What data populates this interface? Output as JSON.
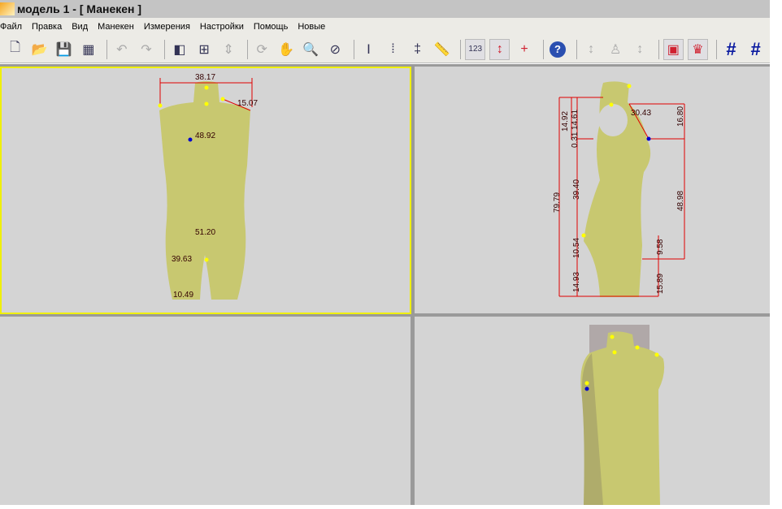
{
  "title": "модель 1 - [ Манекен     ]",
  "menu": [
    "Файл",
    "Правка",
    "Вид",
    "Манекен",
    "Измерения",
    "Настройки",
    "Помощь",
    "Новые"
  ],
  "toolbar": [
    {
      "icon": "new-document-icon"
    },
    {
      "icon": "open-folder-icon"
    },
    {
      "icon": "save-icon"
    },
    {
      "icon": "save-all-icon"
    },
    {
      "icon": "undo-icon"
    },
    {
      "icon": "redo-icon"
    },
    {
      "icon": "view-cube-icon"
    },
    {
      "icon": "layout-icon"
    },
    {
      "icon": "fit-icon"
    },
    {
      "icon": "rotate-icon"
    },
    {
      "icon": "pan-hand-icon"
    },
    {
      "icon": "zoom-icon"
    },
    {
      "icon": "zoom-window-icon"
    },
    {
      "icon": "vertical-measure-icon"
    },
    {
      "icon": "vertical-measure-2-icon"
    },
    {
      "icon": "vertical-measure-3-icon"
    },
    {
      "icon": "ruler-icon"
    },
    {
      "icon": "show-values-icon",
      "active": true
    },
    {
      "icon": "mannequin-height-icon",
      "active": true
    },
    {
      "icon": "add-mannequin-icon"
    },
    {
      "icon": "help-icon"
    },
    {
      "icon": "mannequin-gray-1-icon"
    },
    {
      "icon": "mannequin-gray-2-icon"
    },
    {
      "icon": "mannequin-gray-3-icon"
    },
    {
      "icon": "mannequin-red-frame-icon",
      "active": true
    },
    {
      "icon": "mannequin-points-icon",
      "active": true
    },
    {
      "icon": "grid-icon"
    },
    {
      "icon": "grid-height-icon"
    }
  ],
  "front_view": {
    "labels": [
      "38.17",
      "15.07",
      "48.92",
      "51.20",
      "39.63",
      "10.49"
    ]
  },
  "side_view": {
    "labels": [
      "14.92",
      "14.61",
      "0.31",
      "39.40",
      "79.79",
      "10.54",
      "14.93",
      "30.43",
      "16.80",
      "48.98",
      "9.58",
      "15.89"
    ]
  },
  "colors": {
    "body": "#c8c870",
    "dimension": "#e00000",
    "active_border": "#f0f000"
  }
}
